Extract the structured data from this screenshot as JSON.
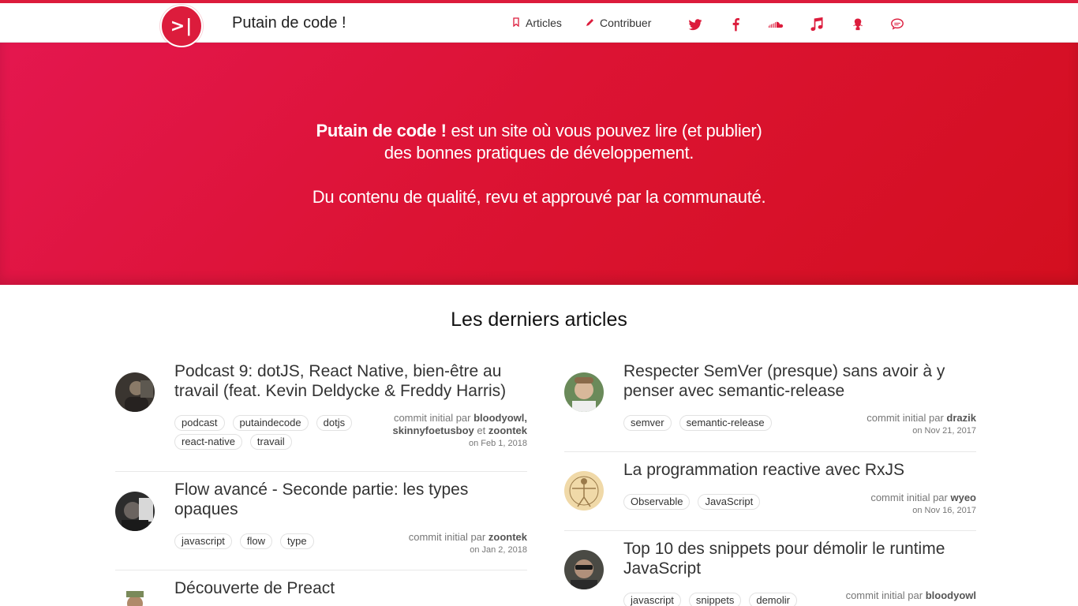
{
  "header": {
    "logo_text": ">|",
    "site_title": "Putain de code !",
    "nav": [
      {
        "label": "Articles",
        "icon": "bookmark-icon"
      },
      {
        "label": "Contribuer",
        "icon": "pencil-icon"
      }
    ],
    "social_icons": [
      "twitter-icon",
      "facebook-icon",
      "soundcloud-icon",
      "music-note-icon",
      "github-icon",
      "chat-icon"
    ],
    "accent_color": "#dc1c3c"
  },
  "hero": {
    "line1_bold": "Putain de code !",
    "line1_rest": " est un site où vous pouvez lire (et publier)",
    "line2": "des bonnes pratiques de développement.",
    "line3": "Du contenu de qualité, revu et approuvé par la communauté."
  },
  "articles_section": {
    "title": "Les derniers articles",
    "meta_prefix": "commit initial par",
    "left": [
      {
        "title": "Podcast 9: dotJS, React Native, bien-être au travail (feat. Kevin Deldycke & Freddy Harris)",
        "tags": [
          "podcast",
          "putaindecode",
          "dotjs",
          "react-native",
          "travail"
        ],
        "authors_line1": "bloodyowl,",
        "authors_line2a": "skinnyfoetusboy",
        "authors_conj": "et",
        "authors_line2b": "zoontek",
        "date": "on Feb 1, 2018"
      },
      {
        "title": "Flow avancé - Seconde partie: les types opaques",
        "tags": [
          "javascript",
          "flow",
          "type"
        ],
        "author": "zoontek",
        "date": "on Jan 2, 2018"
      },
      {
        "title": "Découverte de Preact"
      }
    ],
    "right": [
      {
        "title": "Respecter SemVer (presque) sans avoir à y penser avec semantic-release",
        "tags": [
          "semver",
          "semantic-release"
        ],
        "author": "drazik",
        "date": "on Nov 21, 2017"
      },
      {
        "title": "La programmation reactive avec RxJS",
        "tags": [
          "Observable",
          "JavaScript"
        ],
        "author": "wyeo",
        "date": "on Nov 16, 2017"
      },
      {
        "title": "Top 10 des snippets pour démolir le runtime JavaScript",
        "tags": [
          "javascript",
          "snippets",
          "demolir"
        ],
        "author": "bloodyowl"
      }
    ]
  }
}
